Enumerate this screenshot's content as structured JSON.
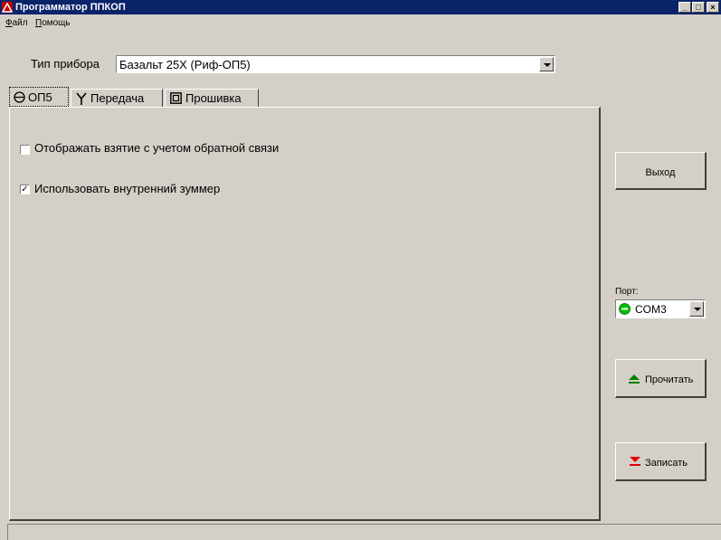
{
  "window": {
    "title": "Программатор ППКОП"
  },
  "menu": [
    {
      "accel": "Ф",
      "rest": "айл"
    },
    {
      "accel": "П",
      "rest": "омощь"
    }
  ],
  "device": {
    "label": "Тип прибора",
    "value": "Базальт 25Х (Риф-ОП5)"
  },
  "tabs": [
    {
      "label": "ОП5"
    },
    {
      "label": "Передача"
    },
    {
      "label": "Прошивка"
    }
  ],
  "options": [
    {
      "label": "Отображать взятие с учетом обратной связи",
      "checked": false
    },
    {
      "label": "Использовать внутренний зуммер",
      "checked": true
    }
  ],
  "side": {
    "exit_label": "Выход",
    "port_label": "Порт:",
    "port_value": "COM3",
    "port_status_color": "#00c000",
    "read_label": "Прочитать",
    "read_icon_color": "#008000",
    "write_label": "Записать",
    "write_icon_color": "#e00000"
  }
}
